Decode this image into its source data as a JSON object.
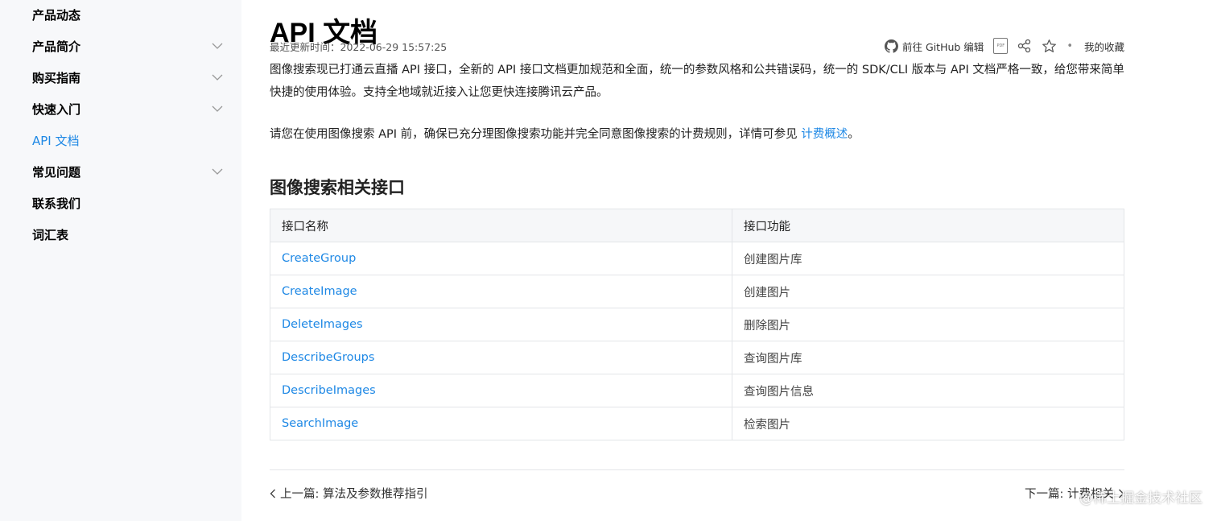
{
  "sidebar": {
    "items": [
      {
        "label": "产品动态",
        "expandable": false,
        "active": false
      },
      {
        "label": "产品简介",
        "expandable": true,
        "active": false
      },
      {
        "label": "购买指南",
        "expandable": true,
        "active": false
      },
      {
        "label": "快速入门",
        "expandable": true,
        "active": false
      },
      {
        "label": "API 文档",
        "expandable": false,
        "active": true
      },
      {
        "label": "常见问题",
        "expandable": true,
        "active": false
      },
      {
        "label": "联系我们",
        "expandable": false,
        "active": false
      },
      {
        "label": "词汇表",
        "expandable": false,
        "active": false
      }
    ]
  },
  "page": {
    "title": "API 文档",
    "last_updated": "最近更新时间：2022-06-29 15:57:25"
  },
  "toolbar": {
    "github_label": "前往 GitHub 编辑",
    "pdf_icon_text": "PDF",
    "favorites_label": "我的收藏"
  },
  "intro": {
    "para1": "图像搜索现已打通云直播 API 接口，全新的 API 接口文档更加规范和全面，统一的参数风格和公共错误码，统一的 SDK/CLI 版本与 API 文档严格一致，给您带来简单快捷的使用体验。支持全地域就近接入让您更快连接腾讯云产品。",
    "para2_prefix": "请您在使用图像搜索 API 前，确保已充分理图像搜索功能并完全同意图像搜索的计费规则，详情可参见 ",
    "para2_link": "计费概述",
    "para2_suffix": "。"
  },
  "section": {
    "title": "图像搜索相关接口"
  },
  "api_table": {
    "headers": [
      "接口名称",
      "接口功能"
    ],
    "rows": [
      {
        "name": "CreateGroup",
        "function": "创建图片库"
      },
      {
        "name": "CreateImage",
        "function": "创建图片"
      },
      {
        "name": "DeleteImages",
        "function": "删除图片"
      },
      {
        "name": "DescribeGroups",
        "function": "查询图片库"
      },
      {
        "name": "DescribeImages",
        "function": "查询图片信息"
      },
      {
        "name": "SearchImage",
        "function": "检索图片"
      }
    ]
  },
  "pager": {
    "prev": "上一篇: 算法及参数推荐指引",
    "next": "下一篇: 计费相关"
  },
  "watermark": "@稀土掘金技术社区",
  "colors": {
    "accent": "#1e88e5",
    "sidebar_bg": "#f7f8fa",
    "border": "#e3e5e8"
  }
}
